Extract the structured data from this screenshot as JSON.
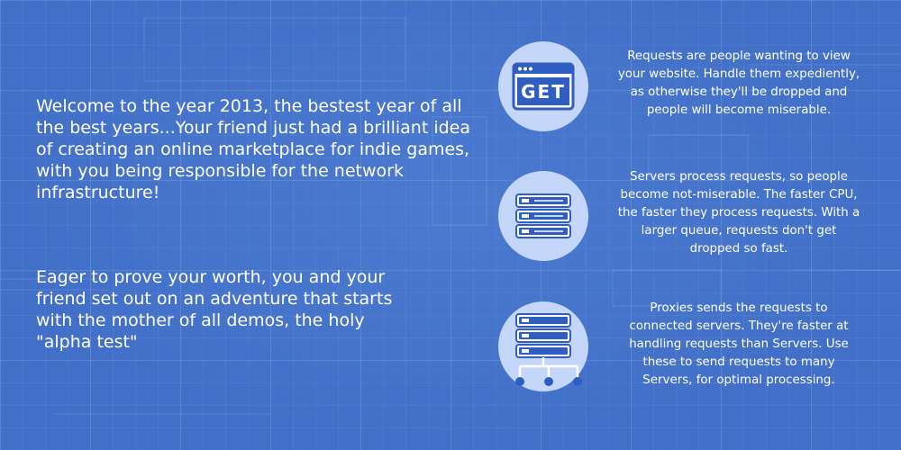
{
  "intro": {
    "paragraph_1": "Welcome to the year 2013, the bestest year of all the best years...Your friend just had a brilliant idea of creating an online marketplace for indie games, with you being responsible for the network infrastructure!",
    "paragraph_2": "Eager to prove your worth, you and your friend set out on an adventure that starts with the mother of all demos, the holy \"alpha test\""
  },
  "items": [
    {
      "icon": "get-request-icon",
      "icon_label": "GET",
      "description": "Requests are people wanting to view your website. Handle them expediently, as otherwise they'll be dropped and people will become miserable."
    },
    {
      "icon": "server-icon",
      "description": "Servers process requests, so people become not-miserable. The faster CPU, the faster they process requests. With a larger queue, requests don't get dropped so fast."
    },
    {
      "icon": "proxy-icon",
      "description": "Proxies sends the requests to connected servers. They're faster at handling requests than Servers. Use these to send requests to many Servers, for optimal processing."
    }
  ],
  "colors": {
    "background": "#4270c8",
    "circle": "#c5d6fb",
    "icon_blue": "#2f5ec0",
    "text": "#ffffff"
  }
}
